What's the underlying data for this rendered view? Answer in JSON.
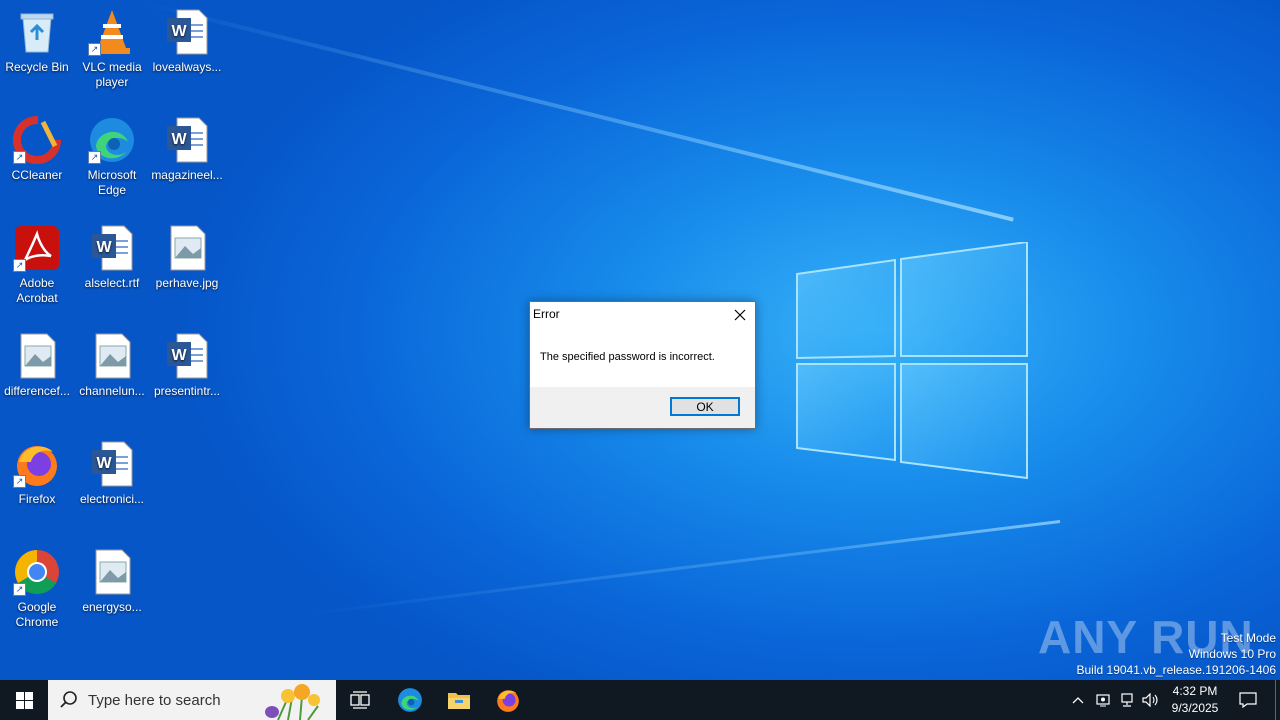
{
  "desktop": {
    "icons": [
      {
        "label": "Recycle Bin",
        "icon": "recycle-bin-icon"
      },
      {
        "label": "VLC media player",
        "icon": "vlc-icon"
      },
      {
        "label": "lovealways...",
        "icon": "word-document-icon"
      },
      {
        "label": "CCleaner",
        "icon": "ccleaner-icon"
      },
      {
        "label": "Microsoft Edge",
        "icon": "edge-icon"
      },
      {
        "label": "magazineel...",
        "icon": "word-document-icon"
      },
      {
        "label": "Adobe Acrobat",
        "icon": "acrobat-icon"
      },
      {
        "label": "alselect.rtf",
        "icon": "word-document-icon"
      },
      {
        "label": "perhave.jpg",
        "icon": "image-file-icon"
      },
      {
        "label": "differencef...",
        "icon": "image-file-icon"
      },
      {
        "label": "channelun...",
        "icon": "image-file-icon"
      },
      {
        "label": "presentintr...",
        "icon": "word-document-icon"
      },
      {
        "label": "Firefox",
        "icon": "firefox-icon"
      },
      {
        "label": "electronici...",
        "icon": "word-document-icon"
      },
      {
        "label": "Google Chrome",
        "icon": "chrome-icon"
      },
      {
        "label": "energyso...",
        "icon": "image-file-icon"
      }
    ]
  },
  "dialog": {
    "title": "Error",
    "message": "The specified password is incorrect.",
    "ok_label": "OK"
  },
  "watermark": {
    "brand": "ANY RUN",
    "mode": "Test Mode",
    "edition": "Windows 10 Pro",
    "build": "Build 19041.vb_release.191206-1406"
  },
  "taskbar": {
    "search_placeholder": "Type here to search",
    "pinned": [
      "task-view-icon",
      "edge-icon",
      "file-explorer-icon",
      "firefox-icon"
    ],
    "time": "4:32 PM",
    "date": "9/3/2025"
  },
  "colors": {
    "accent": "#0078d7",
    "taskbar": "#101822",
    "desktop": "#0a66d8"
  }
}
